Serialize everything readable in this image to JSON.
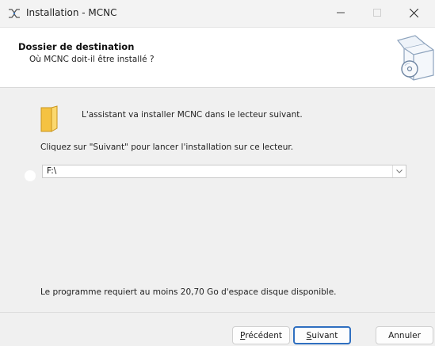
{
  "window": {
    "title": "Installation - MCNC"
  },
  "header": {
    "title": "Dossier de destination",
    "subtitle": "Où MCNC doit-il être installé ?"
  },
  "content": {
    "intro": "L'assistant va installer MCNC dans le lecteur suivant.",
    "instruction": "Cliquez sur \"Suivant\" pour lancer l'installation sur ce lecteur.",
    "drive_value": "F:\\",
    "space_required": "Le programme requiert au moins 20,70 Go d'espace disque disponible."
  },
  "buttons": {
    "back": {
      "accel": "P",
      "rest": "récédent"
    },
    "next": {
      "accel": "S",
      "rest": "uivant"
    },
    "cancel": "Annuler"
  },
  "icons": {
    "app": "installer-icon",
    "header": "install-box-cd-icon",
    "folder": "folder-icon",
    "dropdown": "chevron-down-icon"
  },
  "colors": {
    "default_button_border": "#2f6fc0",
    "folder": "#f5c242"
  }
}
